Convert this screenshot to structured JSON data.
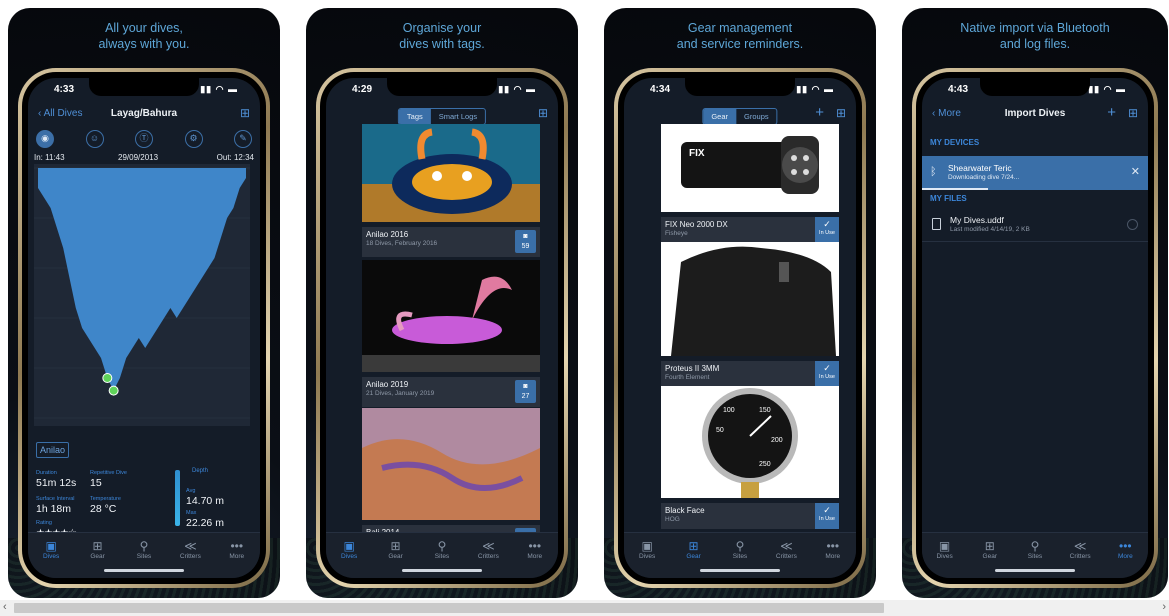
{
  "panels": [
    {
      "caption": [
        "All your dives,",
        "always with you."
      ]
    },
    {
      "caption": [
        "Organise your",
        "dives with tags."
      ]
    },
    {
      "caption": [
        "Gear management",
        "and service reminders."
      ]
    },
    {
      "caption": [
        "Native import via Bluetooth",
        "and log files."
      ]
    }
  ],
  "dive": {
    "time": "4:33",
    "back": "All Dives",
    "title": "Layag/Bahura",
    "in": "In: 11:43",
    "date": "29/09/2013",
    "out": "Out: 12:34",
    "tag": "Anilao",
    "duration_label": "Duration",
    "duration": "51m 12s",
    "repetitive_label": "Repetitive Dive",
    "repetitive": "15",
    "surface_label": "Surface Interval",
    "surface": "1h 18m",
    "temp_label": "Temperature",
    "temp": "28 °C",
    "rating_label": "Rating",
    "rating": "★★★★☆",
    "depth_label": "Depth",
    "avg_label": "Avg",
    "avg": "14.70 m",
    "max_label": "Max",
    "max": "22.26 m"
  },
  "tags": {
    "time": "4:29",
    "seg": [
      "Tags",
      "Smart Logs"
    ],
    "albums": [
      {
        "title": "Anilao 2016",
        "sub": "18 Dives, February 2016",
        "count": "59"
      },
      {
        "title": "Anilao 2019",
        "sub": "21 Dives, January 2019",
        "count": "27"
      },
      {
        "title": "Bali 2014",
        "sub": "",
        "count": ""
      }
    ]
  },
  "gear": {
    "time": "4:34",
    "seg": [
      "Gear",
      "Groups"
    ],
    "inuse": "In Use",
    "items": [
      {
        "name": "FIX Neo 2000 DX",
        "brand": "Fisheye"
      },
      {
        "name": "Proteus II 3MM",
        "brand": "Fourth Element"
      },
      {
        "name": "Black Face",
        "brand": "HOG"
      }
    ]
  },
  "import": {
    "time": "4:43",
    "back": "More",
    "title": "Import Dives",
    "devices_header": "MY DEVICES",
    "device_name": "Shearwater Teric",
    "device_status": "Downloading dive 7/24...",
    "download_progress": 0.29,
    "files_header": "MY FILES",
    "file_name": "My Dives.uddf",
    "file_meta": "Last modified 4/14/19, 2 KB"
  },
  "tabbar": [
    "Dives",
    "Gear",
    "Sites",
    "Critters",
    "More"
  ],
  "chart_data": {
    "type": "area",
    "title": "",
    "xlabel": "",
    "ylabel": "",
    "series": [
      {
        "values": [
          2,
          3,
          4,
          6,
          8,
          11,
          14,
          16,
          17,
          18,
          19,
          21,
          22.26,
          21,
          19,
          18,
          17,
          18,
          17,
          16,
          15,
          14,
          15,
          14,
          13,
          12,
          11,
          10,
          9,
          7,
          5,
          4,
          2,
          1
        ]
      }
    ],
    "ylim": [
      0,
      25
    ]
  }
}
